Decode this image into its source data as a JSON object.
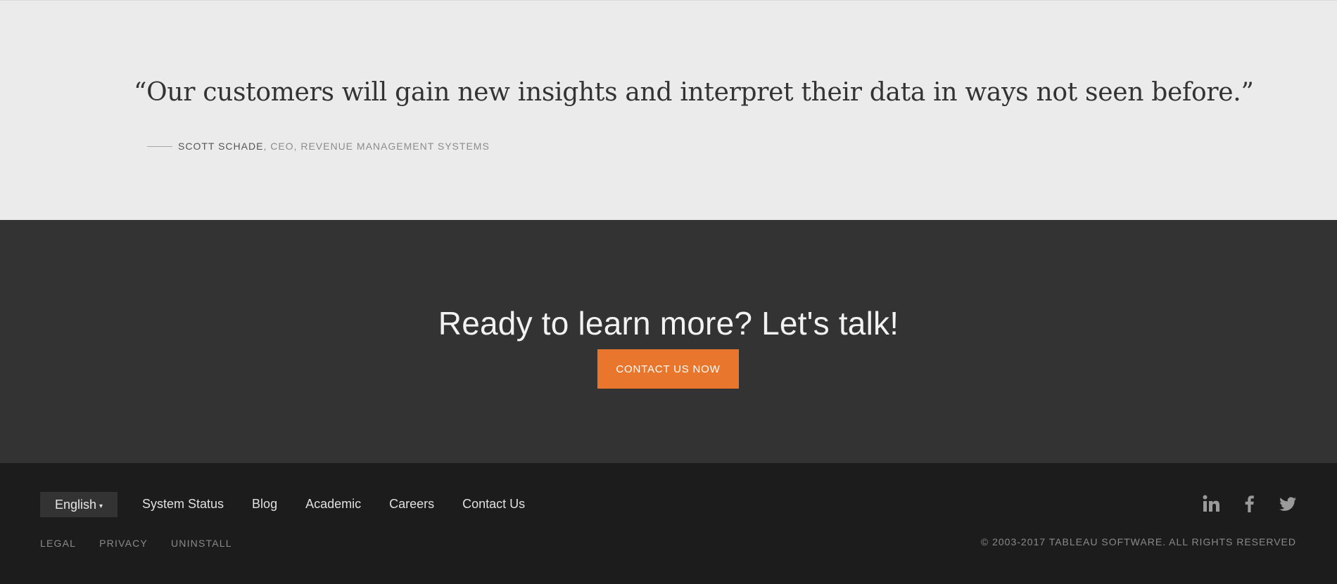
{
  "quote": {
    "text": "“Our customers will gain new insights and interpret their data in ways not seen before.”",
    "author": "SCOTT SCHADE",
    "role": ", CEO, REVENUE MANAGEMENT SYSTEMS"
  },
  "cta": {
    "title": "Ready to learn more? Let's talk!",
    "button_label": "CONTACT US NOW",
    "accent_color": "#e8762d"
  },
  "footer": {
    "language": {
      "selected": "English",
      "caret": "▾"
    },
    "nav": [
      {
        "label": "System Status"
      },
      {
        "label": "Blog"
      },
      {
        "label": "Academic"
      },
      {
        "label": "Careers"
      },
      {
        "label": "Contact Us"
      }
    ],
    "legal": [
      {
        "label": "LEGAL"
      },
      {
        "label": "PRIVACY"
      },
      {
        "label": "UNINSTALL"
      }
    ],
    "social": [
      "linkedin-icon",
      "facebook-icon",
      "twitter-icon"
    ],
    "copyright": "© 2003-2017 TABLEAU SOFTWARE. ALL RIGHTS RESERVED"
  }
}
